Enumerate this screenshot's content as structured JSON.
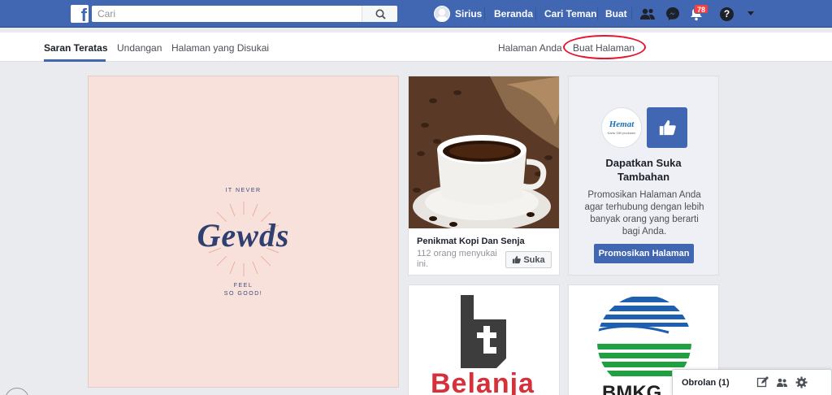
{
  "header": {
    "logo": "f",
    "search_placeholder": "Cari",
    "profile_name": "Sirius",
    "nav": [
      "Beranda",
      "Cari Teman",
      "Buat"
    ],
    "notification_count": "78",
    "help": "?"
  },
  "tabs": {
    "left": [
      "Saran Teratas",
      "Undangan",
      "Halaman yang Disukai"
    ],
    "right": [
      "Halaman Anda",
      "Buat Halaman"
    ]
  },
  "gewds": {
    "top": "IT NEVER",
    "name": "Gewds",
    "bottom1": "FEEL",
    "bottom2": "SO GOOD!"
  },
  "coffee": {
    "title": "Penikmat Kopi Dan Senja",
    "likes": "112 orang menyukai ini.",
    "like_label": "Suka"
  },
  "promo": {
    "logo_text": "Hemat",
    "logo_sub": "Kartu Gift produsen",
    "title": "Dapatkan Suka Tambahan",
    "text": "Promosikan Halaman Anda agar terhubung dengan lebih banyak orang yang berarti bagi Anda.",
    "button": "Promosikan Halaman"
  },
  "belanja": {
    "text": "Belanja"
  },
  "bmkg": {
    "text": "BMKG"
  },
  "chat": {
    "label": "Obrolan (1)"
  },
  "colors": {
    "brand": "#4267b2",
    "accent_red": "#e8122d",
    "badge": "#fa3e3e"
  }
}
